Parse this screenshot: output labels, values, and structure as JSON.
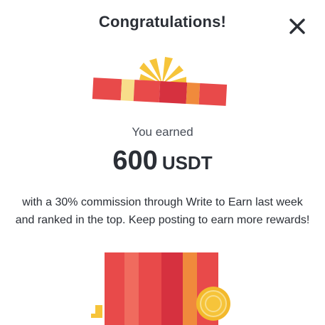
{
  "dialog": {
    "title": "Congratulations!",
    "close_icon": "close-icon"
  },
  "reward": {
    "earned_label": "You earned",
    "amount": "600",
    "currency": "USDT",
    "description": "with a 30% commission through Write to Earn last week and ranked in the top. Keep posting to earn more rewards!"
  },
  "illustration": {
    "gift_lid_icon": "gift-lid-icon",
    "gift_box_icon": "gift-box-icon",
    "coin_icon": "coin-icon",
    "colors": {
      "red": "#e84a4a",
      "dark_red": "#d6313f",
      "light_red": "#f06b5e",
      "yellow": "#f6c43a",
      "pale_yellow": "#f8dd8a",
      "orange": "#f08a3c",
      "coin": "#f3b92c"
    }
  }
}
